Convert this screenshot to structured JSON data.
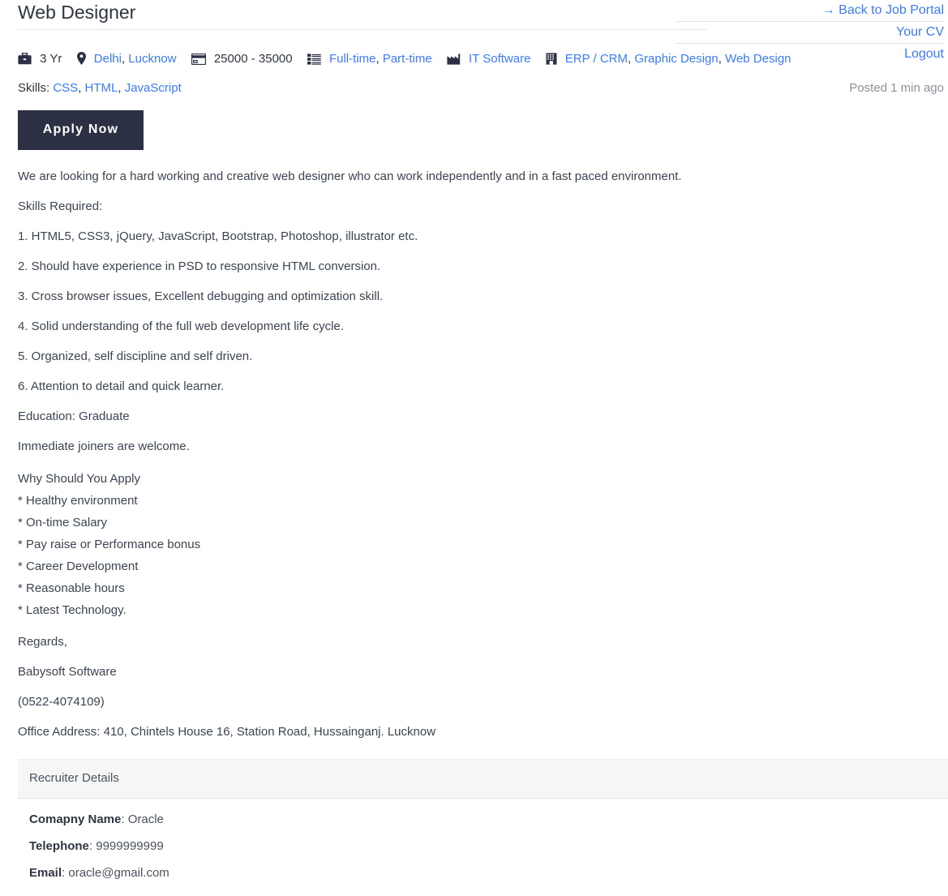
{
  "topnav": {
    "links": [
      {
        "label": "→ Back to Job Portal",
        "name": "back-to-job-portal-link"
      },
      {
        "label": "Your CV",
        "name": "your-cv-link"
      },
      {
        "label": "Logout",
        "name": "logout-link"
      }
    ]
  },
  "job": {
    "title": "Web Designer",
    "posted": "Posted 1 min ago",
    "apply_label": "Apply Now",
    "meta": {
      "experience": "3 Yr",
      "locations": [
        "Delhi",
        "Lucknow"
      ],
      "salary": "25000 - 35000",
      "job_types": [
        "Full-time",
        "Part-time"
      ],
      "industry": "IT Software",
      "functions": [
        "ERP / CRM",
        "Graphic Design",
        "Web Design"
      ]
    },
    "skills_label": "Skills:",
    "skills": [
      "CSS",
      "HTML",
      "JavaScript"
    ],
    "description": {
      "intro": "We are looking for a hard working and creative web designer who can work independently and in a fast paced environment.",
      "skills_required_heading": "Skills Required:",
      "requirements": [
        "1. HTML5, CSS3, jQuery, JavaScript, Bootstrap, Photoshop, illustrator etc.",
        "2. Should have experience in PSD to responsive HTML conversion.",
        "3. Cross browser issues, Excellent debugging and optimization skill.",
        "4. Solid understanding of the full web development life cycle.",
        "5. Organized, self discipline and self driven.",
        "6. Attention to detail and quick learner."
      ],
      "education": "Education: Graduate",
      "joiners": "Immediate joiners are welcome.",
      "why_apply_heading": "Why Should You Apply",
      "why_apply": [
        "* Healthy environment",
        "* On-time Salary",
        "* Pay raise or Performance bonus",
        "* Career Development",
        "* Reasonable hours",
        "* Latest Technology."
      ],
      "regards": "Regards,",
      "company": "Babysoft Software",
      "phone": "(0522-4074109)",
      "address": "Office Address: 410, Chintels House 16, Station Road, Hussainganj. Lucknow"
    }
  },
  "recruiter": {
    "heading": "Recruiter Details",
    "company_key": "Comapny Name",
    "company_value": ": Oracle",
    "telephone_key": "Telephone",
    "telephone_value": ": 9999999999",
    "email_key": "Email",
    "email_value": ": oracle@gmail.com"
  },
  "icons": {
    "experience": "briefcase-icon",
    "location": "map-marker-icon",
    "salary": "credit-card-icon",
    "job_type": "list-icon",
    "industry": "factory-icon",
    "function": "building-icon"
  },
  "colors": {
    "link": "#3a7bfd",
    "button_bg": "#2b3044",
    "text": "#3a4553",
    "muted": "#8a929c",
    "panel_head_bg": "#f6f6f6"
  }
}
